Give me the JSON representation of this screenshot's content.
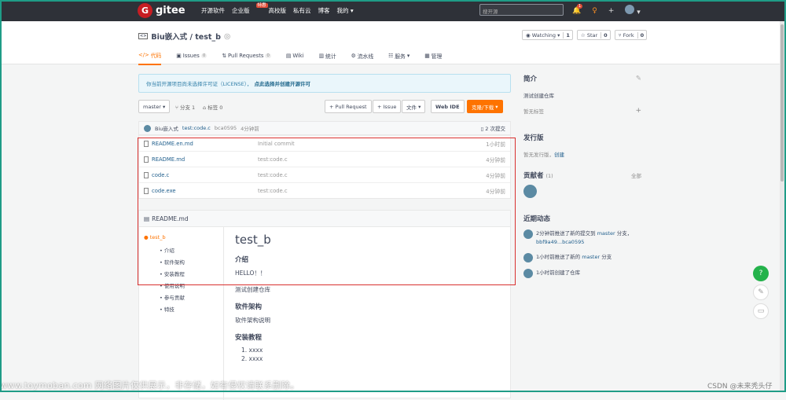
{
  "topbar": {
    "logo_text": "gitee",
    "nav": [
      "开源软件",
      "企业版",
      "高校版",
      "私有云",
      "博客",
      "我的"
    ],
    "enterprise_badge": "特惠",
    "search_placeholder": "搜开源",
    "notify_count": "1"
  },
  "repo": {
    "title": "Biu嵌入式 / test_b",
    "watch": {
      "label": "Watching",
      "count": "1"
    },
    "star": {
      "label": "Star",
      "count": "0"
    },
    "fork": {
      "label": "Fork",
      "count": "0"
    },
    "tabs": [
      {
        "label": "代码"
      },
      {
        "label": "Issues",
        "count": "0"
      },
      {
        "label": "Pull Requests",
        "count": "0"
      },
      {
        "label": "Wiki"
      },
      {
        "label": "统计"
      },
      {
        "label": "流水线"
      },
      {
        "label": "服务"
      },
      {
        "label": "管理"
      }
    ]
  },
  "notice": {
    "text": "你当前开源项目尚未选择许可证（LICENSE），",
    "link": "点此选择并创建开源许可"
  },
  "toolbar": {
    "branch": "master",
    "branches": "分支 1",
    "tags": "标签 0",
    "pull_request": "+ Pull Request",
    "issue": "+ Issue",
    "file": "文件",
    "webide": "Web IDE",
    "clone": "克隆/下载"
  },
  "commit": {
    "author": "Biu嵌入式",
    "message": "test:code.c",
    "hash": "bca0595",
    "time": "4分钟前",
    "count": "2 次提交"
  },
  "files": [
    {
      "name": "README.en.md",
      "msg": "Initial commit",
      "time": "1小时前"
    },
    {
      "name": "README.md",
      "msg": "test:code.c",
      "time": "4分钟前"
    },
    {
      "name": "code.c",
      "msg": "test:code.c",
      "time": "4分钟前"
    },
    {
      "name": "code.exe",
      "msg": "test:code.c",
      "time": "4分钟前"
    }
  ],
  "readme": {
    "header": "README.md",
    "toc_top": "test_b",
    "toc": [
      "介绍",
      "软件架构",
      "安装教程",
      "使用说明",
      "参与贡献",
      "特技"
    ],
    "title": "test_b",
    "h_intro": "介绍",
    "hello": "HELLO！！",
    "desc": "测试创建仓库",
    "h_arch": "软件架构",
    "arch": "软件架构说明",
    "h_install": "安装教程",
    "steps": [
      "xxxx",
      "xxxx"
    ]
  },
  "side": {
    "intro_h": "简介",
    "intro_text": "测试创建仓库",
    "no_tags": "暂无标签",
    "release_h": "发行版",
    "release_text": "暂无发行版，",
    "release_link": "创建",
    "contrib_h": "贡献者",
    "contrib_count": "(1)",
    "all": "全部",
    "activity_h": "近期动态",
    "activities": [
      {
        "pre": "2分钟前推送了新的提交到 ",
        "branch": "master",
        "post": " 分支，",
        "detail": "bbf9a49...bca0595"
      },
      {
        "pre": "1小时前推送了新的 ",
        "branch": "master",
        "post": " 分支",
        "detail": ""
      },
      {
        "pre": "1小时前创建了仓库",
        "branch": "",
        "post": "",
        "detail": ""
      }
    ]
  },
  "watermark": "www.toymoban.com 网络图片仅供展示，非存储，如有侵权请联系删除。",
  "watermark2": "CSDN @未来秃头仔"
}
